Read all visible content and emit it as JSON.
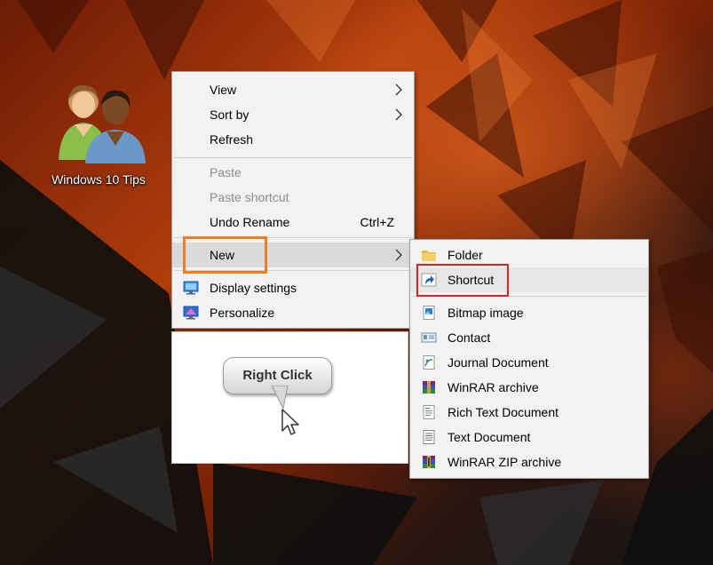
{
  "desktop": {
    "icon_label": "Windows 10 Tips"
  },
  "context_menu": {
    "items": [
      {
        "label": "View",
        "submenu": true
      },
      {
        "label": "Sort by",
        "submenu": true
      },
      {
        "label": "Refresh"
      },
      {
        "label": "Paste",
        "disabled": true
      },
      {
        "label": "Paste shortcut",
        "disabled": true
      },
      {
        "label": "Undo Rename",
        "shortcut": "Ctrl+Z"
      },
      {
        "label": "New",
        "submenu": true,
        "highlighted": true
      },
      {
        "label": "Display settings",
        "icon": "display-settings-icon"
      },
      {
        "label": "Personalize",
        "icon": "personalize-icon"
      }
    ]
  },
  "new_submenu": {
    "items": [
      {
        "label": "Folder",
        "icon": "folder-icon"
      },
      {
        "label": "Shortcut",
        "icon": "shortcut-icon",
        "highlighted": true
      },
      {
        "label": "Bitmap image",
        "icon": "bitmap-icon"
      },
      {
        "label": "Contact",
        "icon": "contact-icon"
      },
      {
        "label": "Journal Document",
        "icon": "journal-icon"
      },
      {
        "label": "WinRAR archive",
        "icon": "winrar-icon"
      },
      {
        "label": "Rich Text Document",
        "icon": "rich-text-icon"
      },
      {
        "label": "Text Document",
        "icon": "text-document-icon"
      },
      {
        "label": "WinRAR ZIP archive",
        "icon": "winrar-zip-icon"
      }
    ]
  },
  "callout": {
    "text": "Right Click"
  },
  "colors": {
    "orange_highlight": "#f07f23",
    "red_highlight": "#e02020",
    "menu_background": "#f2f2f2"
  }
}
